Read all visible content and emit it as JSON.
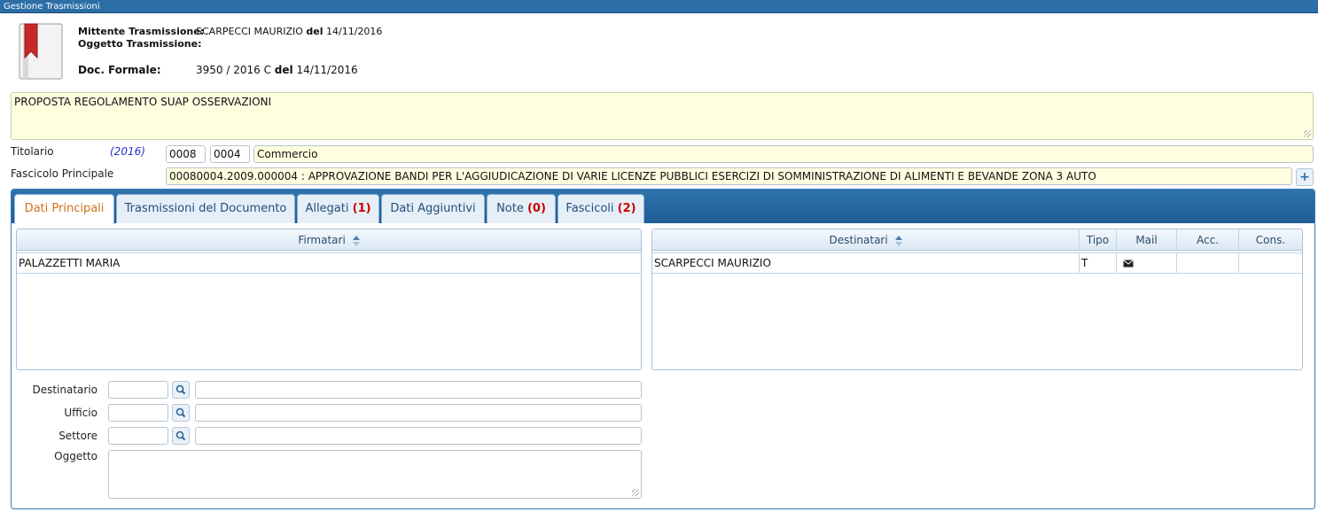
{
  "window": {
    "title": "Gestione Trasmissioni"
  },
  "header": {
    "mittente_label": "Mittente Trasmissione:",
    "mittente_name": "SCARPECCI MAURIZIO",
    "mittente_del": "del",
    "mittente_date": "14/11/2016",
    "oggetto_label": "Oggetto Trasmissione:",
    "doc_label": "Doc. Formale:",
    "doc_number": "3950 / 2016 C",
    "doc_del": "del",
    "doc_date": "14/11/2016"
  },
  "subject": {
    "text": "PROPOSTA REGOLAMENTO SUAP OSSERVAZIONI"
  },
  "titolario": {
    "label": "Titolario",
    "year": "(2016)",
    "code1": "0008",
    "code2": "0004",
    "description": "Commercio"
  },
  "fascicolo": {
    "label": "Fascicolo Principale",
    "value": "00080004.2009.000004 : APPROVAZIONE BANDI PER L'AGGIUDICAZIONE DI VARIE LICENZE PUBBLICI ESERCIZI DI SOMMINISTRAZIONE DI ALIMENTI E BEVANDE ZONA 3 AUTO",
    "add_label": "+"
  },
  "tabs": [
    {
      "label": "Dati Principali",
      "count": "",
      "active": true
    },
    {
      "label": "Trasmissioni del Documento",
      "count": "",
      "active": false
    },
    {
      "label": "Allegati",
      "count": "(1)",
      "active": false
    },
    {
      "label": "Dati Aggiuntivi",
      "count": "",
      "active": false
    },
    {
      "label": "Note",
      "count": "(0)",
      "active": false
    },
    {
      "label": "Fascicoli",
      "count": "(2)",
      "active": false
    }
  ],
  "firmatari": {
    "header": "Firmatari",
    "rows": [
      {
        "name": "PALAZZETTI MARIA"
      }
    ]
  },
  "destinatari": {
    "headers": {
      "name": "Destinatari",
      "tipo": "Tipo",
      "mail": "Mail",
      "acc": "Acc.",
      "cons": "Cons."
    },
    "rows": [
      {
        "name": "SCARPECCI MAURIZIO",
        "tipo": "T",
        "mail_icon": "envelope-icon",
        "acc": "",
        "cons": ""
      }
    ]
  },
  "form": {
    "destinatario_label": "Destinatario",
    "ufficio_label": "Ufficio",
    "settore_label": "Settore",
    "oggetto_label": "Oggetto"
  },
  "colors": {
    "titlebar": "#2c6ea6",
    "tab_active_text": "#d2711a",
    "count": "#cc0000",
    "yellow_field": "#ffffe0"
  }
}
